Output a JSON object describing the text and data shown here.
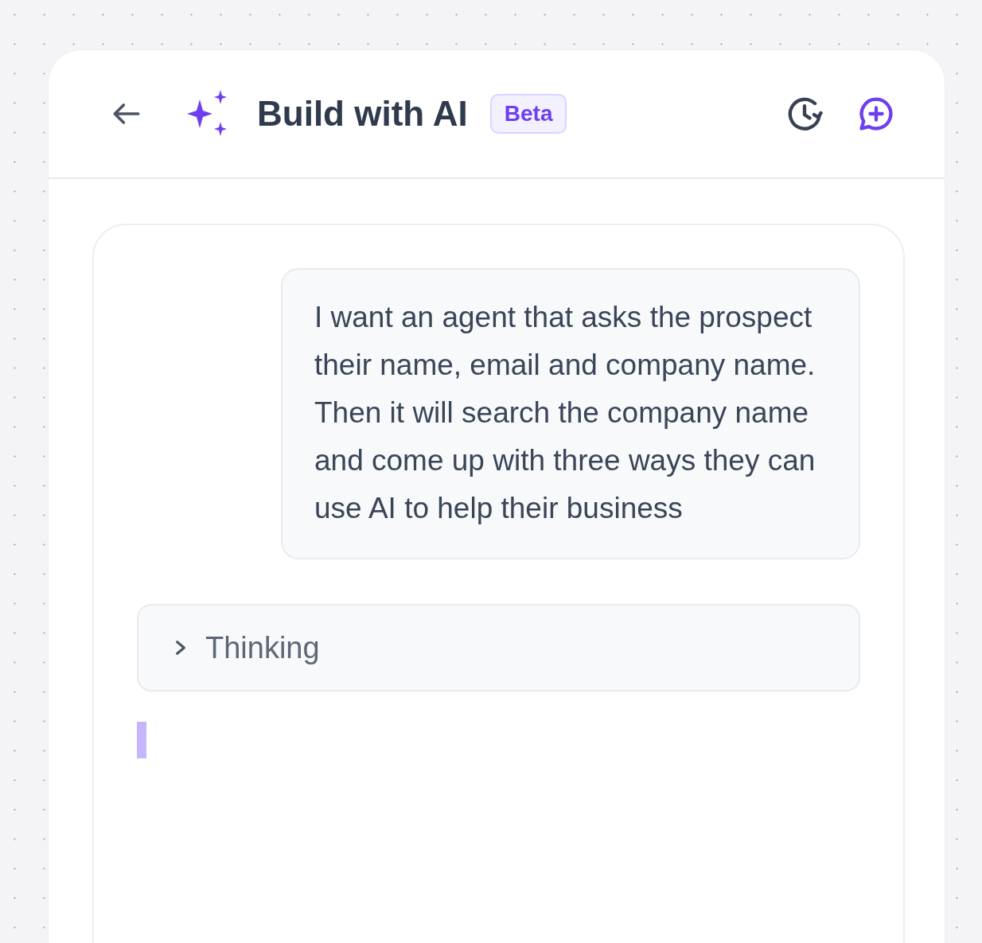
{
  "header": {
    "title": "Build with AI",
    "badge": "Beta"
  },
  "messages": [
    {
      "kind": "user",
      "text": "I want an agent that asks the prospect their name, email and company name. Then it will search the company name and come up with three ways they can use AI to help their business"
    },
    {
      "kind": "thinking",
      "text": "Thinking",
      "expanded": false
    }
  ]
}
